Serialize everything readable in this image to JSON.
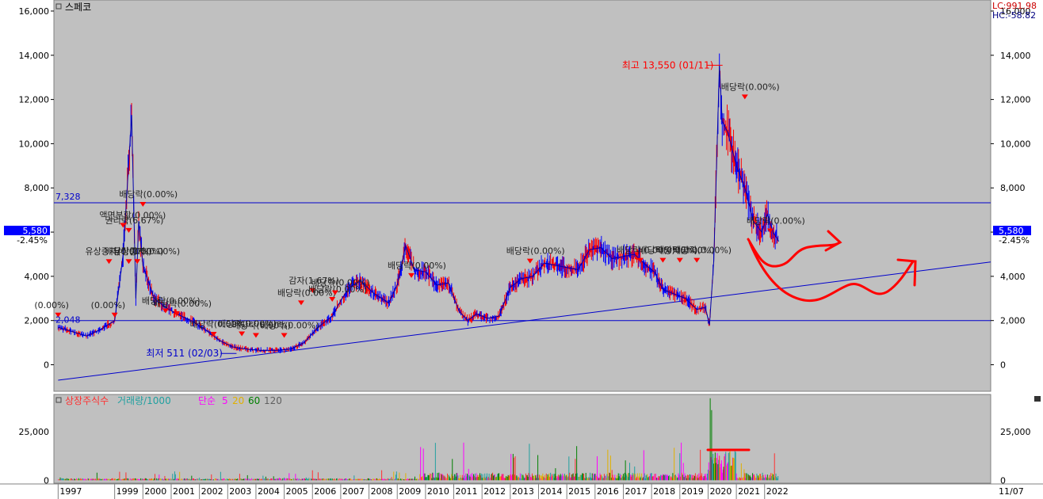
{
  "chart_data": {
    "type": "line",
    "title": "스페코",
    "readout_right": {
      "lc": "LC:991.98",
      "hc": "HC:-58.82"
    },
    "last": {
      "value": "5,580",
      "change": "-2.45%"
    },
    "price_axis": {
      "min": -1200,
      "max": 16500,
      "ticks": [
        "16,000",
        "14,000",
        "12,000",
        "10,000",
        "8,000",
        "6,000",
        "4,000",
        "2,000",
        "0"
      ],
      "tick_values": [
        16000,
        14000,
        12000,
        10000,
        8000,
        6000,
        4000,
        2000,
        0
      ]
    },
    "hlines": [
      {
        "label": "7,328",
        "value": 7328
      },
      {
        "value": 2000
      }
    ],
    "trendline": [
      {
        "date": 1997.0,
        "value": -700
      },
      {
        "date": 2030.0,
        "value": 4650
      }
    ],
    "extremes": {
      "high": "최고 13,550 (01/11)",
      "low": "최저 511 (02/03)",
      "start": "2,048"
    },
    "series": [
      {
        "name": "스페코",
        "x": [
          1997.0,
          1997.5,
          1998.0,
          1998.5,
          1999.0,
          1999.3,
          1999.6,
          1999.75,
          1999.85,
          2000.0,
          2000.4,
          2000.8,
          2001.2,
          2001.7,
          2002.2,
          2002.7,
          2003.2,
          2003.7,
          2004.2,
          2004.7,
          2005.2,
          2005.7,
          2006.2,
          2006.7,
          2007.0,
          2007.3,
          2007.7,
          2008.2,
          2008.7,
          2009.0,
          2009.3,
          2009.6,
          2010.0,
          2010.4,
          2010.8,
          2011.2,
          2011.5,
          2011.8,
          2012.2,
          2012.6,
          2013.0,
          2013.4,
          2013.8,
          2014.2,
          2014.6,
          2015.0,
          2015.4,
          2015.8,
          2016.2,
          2016.6,
          2017.0,
          2017.4,
          2017.8,
          2018.1,
          2018.4,
          2018.8,
          2019.2,
          2019.6,
          2019.9,
          2020.05,
          2020.2,
          2020.3,
          2020.4,
          2020.5,
          2020.7,
          2021.0,
          2021.3,
          2021.6,
          2021.9,
          2022.1,
          2022.3,
          2022.5
        ],
        "values": [
          1700,
          1500,
          1300,
          1600,
          2000,
          5000,
          11300,
          3000,
          6500,
          4500,
          3000,
          2600,
          2300,
          2000,
          1600,
          1100,
          800,
          700,
          650,
          650,
          700,
          1000,
          1700,
          2200,
          2900,
          3500,
          3800,
          3200,
          2800,
          3600,
          5400,
          4300,
          4200,
          3600,
          3700,
          2400,
          2000,
          2300,
          2100,
          2200,
          3500,
          3900,
          4000,
          4600,
          4500,
          4400,
          4300,
          5200,
          5300,
          4800,
          4900,
          5000,
          4500,
          4200,
          3400,
          3200,
          3000,
          2500,
          2600,
          1800,
          4700,
          9000,
          13550,
          11000,
          10500,
          9000,
          8000,
          6500,
          6000,
          6800,
          6000,
          5580
        ]
      }
    ],
    "x_axis": {
      "labels": [
        "1997",
        "1999",
        "2000",
        "2001",
        "2002",
        "2003",
        "2004",
        "2005",
        "2006",
        "2007",
        "2008",
        "2009",
        "2010",
        "2011",
        "2012",
        "2013",
        "2014",
        "2015",
        "2016",
        "2017",
        "2018",
        "2019",
        "2020",
        "2021",
        "2022"
      ],
      "right_label": "11/07"
    },
    "annotations": [
      {
        "text": "배당락(0.00%)",
        "date": 2000.0,
        "value": 7580
      },
      {
        "text": "액면분할(0.00%)",
        "date": 1999.3,
        "value": 6630
      },
      {
        "text": "권리락(6.67%)",
        "date": 1999.5,
        "value": 6400
      },
      {
        "text": "유상증자(0.00%)",
        "date": 1998.8,
        "value": 4990
      },
      {
        "text": "무상증자(0.00%)",
        "date": 1999.8,
        "value": 4990
      },
      {
        "text": "배당락(0.00%)",
        "date": 1999.5,
        "value": 4990
      },
      {
        "text": "배당락(0.00%)",
        "date": 2000.8,
        "value": 2760
      },
      {
        "text": "배당락(0.00%)",
        "date": 2001.2,
        "value": 2640
      },
      {
        "text": "(0.00%)",
        "date": 1997.0,
        "value": 2570
      },
      {
        "text": "(0.00%)",
        "date": 1999.0,
        "value": 2570
      },
      {
        "text": "배당락(0.00%)",
        "date": 2002.5,
        "value": 1700
      },
      {
        "text": "배당락(0.00%)",
        "date": 2003.5,
        "value": 1720
      },
      {
        "text": "배당락(0.00%)",
        "date": 2004.0,
        "value": 1650
      },
      {
        "text": "배당락(0.00%)",
        "date": 2005.0,
        "value": 1650
      },
      {
        "text": "감자(1.67%)",
        "date": 2006.0,
        "value": 3680
      },
      {
        "text": "배당락(0.00%)",
        "date": 2005.6,
        "value": 3120
      },
      {
        "text": "배당락(0.00%)",
        "date": 2006.7,
        "value": 3280
      },
      {
        "text": "배당락(0.00%)",
        "date": 2006.8,
        "value": 3580
      },
      {
        "text": "배당락(0.00%)",
        "date": 2009.5,
        "value": 4360
      },
      {
        "text": "배당락(0.00%)",
        "date": 2013.7,
        "value": 5010
      },
      {
        "text": "배당락(0.00%)",
        "date": 2017.6,
        "value": 5050
      },
      {
        "text": "배당락(0.00%)",
        "date": 2018.4,
        "value": 5050
      },
      {
        "text": "배당락(0.00%)",
        "date": 2019.0,
        "value": 5050
      },
      {
        "text": "배당락(0.00%)",
        "date": 2019.6,
        "value": 5050
      },
      {
        "text": "배당락(0.00%)",
        "date": 2021.3,
        "value": 12440
      },
      {
        "text": "배당락(0.00%)",
        "date": 2022.2,
        "value": 6380
      }
    ],
    "volume_panel": {
      "legend": [
        {
          "text": "상장주식수",
          "color": "#ff3030"
        },
        {
          "text": "거래량/1000",
          "color": "#20a0a0"
        },
        {
          "text": "단순",
          "color": "#ff00ff"
        },
        {
          "text": "5",
          "color": "#ff00ff"
        },
        {
          "text": "20",
          "color": "#e0b000"
        },
        {
          "text": "60",
          "color": "#008000"
        },
        {
          "text": "120",
          "color": "#606060"
        }
      ],
      "axis": {
        "min": -1500,
        "max": 44000,
        "ticks": [
          "25,000",
          "0"
        ],
        "tick_values": [
          25000,
          0
        ]
      }
    }
  }
}
